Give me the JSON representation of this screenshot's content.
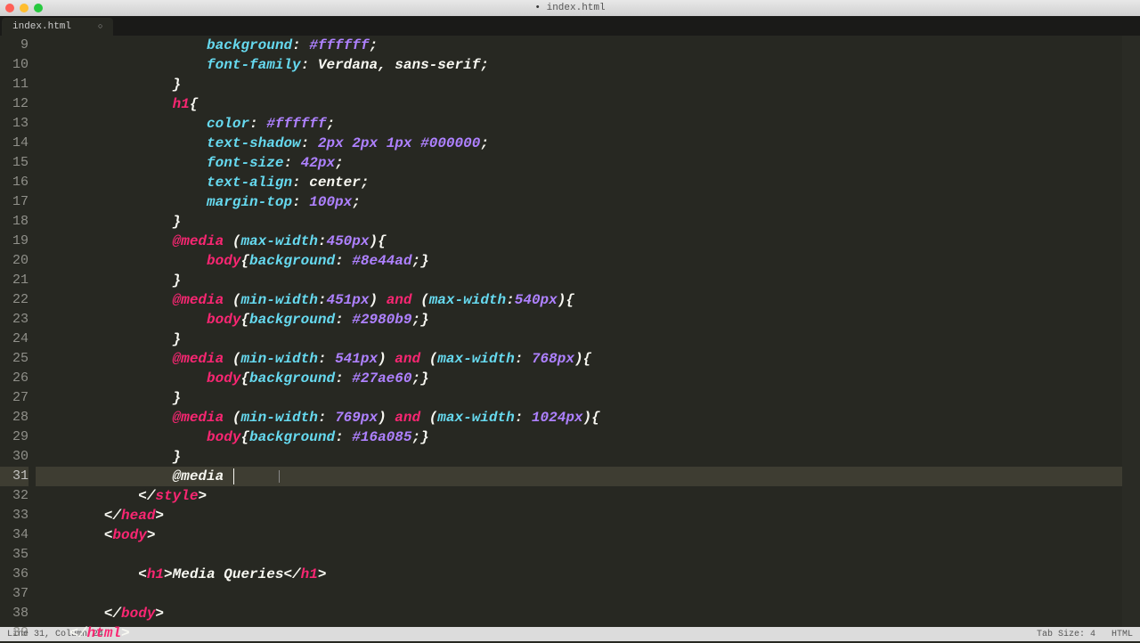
{
  "titlebar": {
    "filename": "index.html",
    "modified_indicator": "•"
  },
  "tab": {
    "label": "index.html",
    "modified": "○"
  },
  "gutter": {
    "start": 9,
    "end": 39,
    "active": 31
  },
  "code": {
    "lines": [
      [
        {
          "t": "                    ",
          "c": "c-white"
        },
        {
          "t": "background",
          "c": "c-prop"
        },
        {
          "t": ": ",
          "c": "c-white"
        },
        {
          "t": "#ffffff",
          "c": "c-num"
        },
        {
          "t": ";",
          "c": "c-white"
        }
      ],
      [
        {
          "t": "                    ",
          "c": "c-white"
        },
        {
          "t": "font-family",
          "c": "c-prop"
        },
        {
          "t": ": Verdana, sans-serif;",
          "c": "c-white"
        }
      ],
      [
        {
          "t": "                }",
          "c": "c-white"
        }
      ],
      [
        {
          "t": "                ",
          "c": "c-white"
        },
        {
          "t": "h1",
          "c": "c-key"
        },
        {
          "t": "{",
          "c": "c-white"
        }
      ],
      [
        {
          "t": "                    ",
          "c": "c-white"
        },
        {
          "t": "color",
          "c": "c-prop"
        },
        {
          "t": ": ",
          "c": "c-white"
        },
        {
          "t": "#ffffff",
          "c": "c-num"
        },
        {
          "t": ";",
          "c": "c-white"
        }
      ],
      [
        {
          "t": "                    ",
          "c": "c-white"
        },
        {
          "t": "text-shadow",
          "c": "c-prop"
        },
        {
          "t": ": ",
          "c": "c-white"
        },
        {
          "t": "2px",
          "c": "c-num"
        },
        {
          "t": " ",
          "c": "c-white"
        },
        {
          "t": "2px",
          "c": "c-num"
        },
        {
          "t": " ",
          "c": "c-white"
        },
        {
          "t": "1px",
          "c": "c-num"
        },
        {
          "t": " ",
          "c": "c-white"
        },
        {
          "t": "#000000",
          "c": "c-num"
        },
        {
          "t": ";",
          "c": "c-white"
        }
      ],
      [
        {
          "t": "                    ",
          "c": "c-white"
        },
        {
          "t": "font-size",
          "c": "c-prop"
        },
        {
          "t": ": ",
          "c": "c-white"
        },
        {
          "t": "42px",
          "c": "c-num"
        },
        {
          "t": ";",
          "c": "c-white"
        }
      ],
      [
        {
          "t": "                    ",
          "c": "c-white"
        },
        {
          "t": "text-align",
          "c": "c-prop"
        },
        {
          "t": ": center;",
          "c": "c-white"
        }
      ],
      [
        {
          "t": "                    ",
          "c": "c-white"
        },
        {
          "t": "margin-top",
          "c": "c-prop"
        },
        {
          "t": ": ",
          "c": "c-white"
        },
        {
          "t": "100px",
          "c": "c-num"
        },
        {
          "t": ";",
          "c": "c-white"
        }
      ],
      [
        {
          "t": "                }",
          "c": "c-white"
        }
      ],
      [
        {
          "t": "                ",
          "c": "c-white"
        },
        {
          "t": "@media",
          "c": "c-key"
        },
        {
          "t": " (",
          "c": "c-white"
        },
        {
          "t": "max-width",
          "c": "c-prop"
        },
        {
          "t": ":",
          "c": "c-white"
        },
        {
          "t": "450px",
          "c": "c-num"
        },
        {
          "t": "){",
          "c": "c-white"
        }
      ],
      [
        {
          "t": "                    ",
          "c": "c-white"
        },
        {
          "t": "body",
          "c": "c-key"
        },
        {
          "t": "{",
          "c": "c-white"
        },
        {
          "t": "background",
          "c": "c-prop"
        },
        {
          "t": ": ",
          "c": "c-white"
        },
        {
          "t": "#8e44ad",
          "c": "c-num"
        },
        {
          "t": ";}",
          "c": "c-white"
        }
      ],
      [
        {
          "t": "                }",
          "c": "c-white"
        }
      ],
      [
        {
          "t": "                ",
          "c": "c-white"
        },
        {
          "t": "@media",
          "c": "c-key"
        },
        {
          "t": " (",
          "c": "c-white"
        },
        {
          "t": "min-width",
          "c": "c-prop"
        },
        {
          "t": ":",
          "c": "c-white"
        },
        {
          "t": "451px",
          "c": "c-num"
        },
        {
          "t": ") ",
          "c": "c-white"
        },
        {
          "t": "and",
          "c": "c-and"
        },
        {
          "t": " (",
          "c": "c-white"
        },
        {
          "t": "max-width",
          "c": "c-prop"
        },
        {
          "t": ":",
          "c": "c-white"
        },
        {
          "t": "540px",
          "c": "c-num"
        },
        {
          "t": "){",
          "c": "c-white"
        }
      ],
      [
        {
          "t": "                    ",
          "c": "c-white"
        },
        {
          "t": "body",
          "c": "c-key"
        },
        {
          "t": "{",
          "c": "c-white"
        },
        {
          "t": "background",
          "c": "c-prop"
        },
        {
          "t": ": ",
          "c": "c-white"
        },
        {
          "t": "#2980b9",
          "c": "c-num"
        },
        {
          "t": ";}",
          "c": "c-white"
        }
      ],
      [
        {
          "t": "                }",
          "c": "c-white"
        }
      ],
      [
        {
          "t": "                ",
          "c": "c-white"
        },
        {
          "t": "@media",
          "c": "c-key"
        },
        {
          "t": " (",
          "c": "c-white"
        },
        {
          "t": "min-width",
          "c": "c-prop"
        },
        {
          "t": ": ",
          "c": "c-white"
        },
        {
          "t": "541px",
          "c": "c-num"
        },
        {
          "t": ") ",
          "c": "c-white"
        },
        {
          "t": "and",
          "c": "c-and"
        },
        {
          "t": " (",
          "c": "c-white"
        },
        {
          "t": "max-width",
          "c": "c-prop"
        },
        {
          "t": ": ",
          "c": "c-white"
        },
        {
          "t": "768px",
          "c": "c-num"
        },
        {
          "t": "){",
          "c": "c-white"
        }
      ],
      [
        {
          "t": "                    ",
          "c": "c-white"
        },
        {
          "t": "body",
          "c": "c-key"
        },
        {
          "t": "{",
          "c": "c-white"
        },
        {
          "t": "background",
          "c": "c-prop"
        },
        {
          "t": ": ",
          "c": "c-white"
        },
        {
          "t": "#27ae60",
          "c": "c-num"
        },
        {
          "t": ";}",
          "c": "c-white"
        }
      ],
      [
        {
          "t": "                }",
          "c": "c-white"
        }
      ],
      [
        {
          "t": "                ",
          "c": "c-white"
        },
        {
          "t": "@media",
          "c": "c-key"
        },
        {
          "t": " (",
          "c": "c-white"
        },
        {
          "t": "min-width",
          "c": "c-prop"
        },
        {
          "t": ": ",
          "c": "c-white"
        },
        {
          "t": "769px",
          "c": "c-num"
        },
        {
          "t": ") ",
          "c": "c-white"
        },
        {
          "t": "and",
          "c": "c-and"
        },
        {
          "t": " (",
          "c": "c-white"
        },
        {
          "t": "max-width",
          "c": "c-prop"
        },
        {
          "t": ": ",
          "c": "c-white"
        },
        {
          "t": "1024px",
          "c": "c-num"
        },
        {
          "t": "){",
          "c": "c-white"
        }
      ],
      [
        {
          "t": "                    ",
          "c": "c-white"
        },
        {
          "t": "body",
          "c": "c-key"
        },
        {
          "t": "{",
          "c": "c-white"
        },
        {
          "t": "background",
          "c": "c-prop"
        },
        {
          "t": ": ",
          "c": "c-white"
        },
        {
          "t": "#16a085",
          "c": "c-num"
        },
        {
          "t": ";}",
          "c": "c-white"
        }
      ],
      [
        {
          "t": "                }",
          "c": "c-white"
        }
      ],
      [
        {
          "t": "                @media ",
          "c": "c-white",
          "cursor": true,
          "caret": true
        }
      ],
      [
        {
          "t": "            </",
          "c": "c-white"
        },
        {
          "t": "style",
          "c": "c-key"
        },
        {
          "t": ">",
          "c": "c-white"
        }
      ],
      [
        {
          "t": "        </",
          "c": "c-white"
        },
        {
          "t": "head",
          "c": "c-key"
        },
        {
          "t": ">",
          "c": "c-white"
        }
      ],
      [
        {
          "t": "        <",
          "c": "c-white"
        },
        {
          "t": "body",
          "c": "c-key"
        },
        {
          "t": ">",
          "c": "c-white"
        }
      ],
      [
        {
          "t": "",
          "c": "c-white"
        }
      ],
      [
        {
          "t": "            <",
          "c": "c-white"
        },
        {
          "t": "h1",
          "c": "c-key"
        },
        {
          "t": ">Media Queries</",
          "c": "c-white"
        },
        {
          "t": "h1",
          "c": "c-key"
        },
        {
          "t": ">",
          "c": "c-white"
        }
      ],
      [
        {
          "t": "",
          "c": "c-white"
        }
      ],
      [
        {
          "t": "        </",
          "c": "c-white"
        },
        {
          "t": "body",
          "c": "c-key"
        },
        {
          "t": ">",
          "c": "c-white"
        }
      ],
      [
        {
          "t": "    </",
          "c": "c-white"
        },
        {
          "t": "html",
          "c": "c-key"
        },
        {
          "t": ">",
          "c": "c-white"
        }
      ]
    ]
  },
  "statusbar": {
    "left": "Line 31, Column 24",
    "right_tab": "Tab Size: 4",
    "right_lang": "HTML"
  }
}
